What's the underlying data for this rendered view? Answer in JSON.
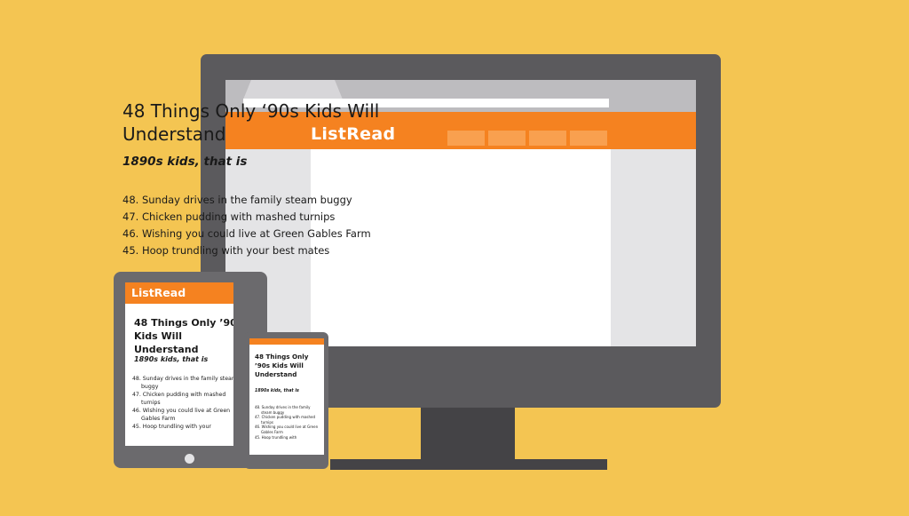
{
  "colors": {
    "background": "#f4c552",
    "brand_orange": "#f58220",
    "monitor_frame": "#5b5a5d"
  },
  "site": {
    "logo": "ListRead"
  },
  "desktop": {
    "title": "48 Things Only ‘90s Kids Will Understand",
    "subtitle": "1890s kids, that is",
    "items": [
      "48. Sunday drives in the family steam buggy",
      "47. Chicken pudding with mashed turnips",
      "46. Wishing you could live at Green Gables Farm",
      "45. Hoop trundling with your best mates"
    ]
  },
  "tablet": {
    "logo": "ListRead",
    "title": "48 Things Only ’90s Kids Will Understand",
    "subtitle": "1890s kids, that is",
    "items": [
      "48. Sunday drives in the family steam buggy",
      "47. Chicken pudding with mashed turnips",
      "46. Wishing you could live at Green Gables Farm",
      "45. Hoop trundling with your"
    ]
  },
  "phone": {
    "title": "48 Things Only ’90s Kids Will Understand",
    "subtitle": "1890s kids, that is",
    "items": [
      "48. Sunday drives in the family steam buggy",
      "47. Chicken pudding with mashed turnips",
      "46. Wishing you could live at Green Gables Farm",
      "45. Hoop trundling with"
    ]
  }
}
